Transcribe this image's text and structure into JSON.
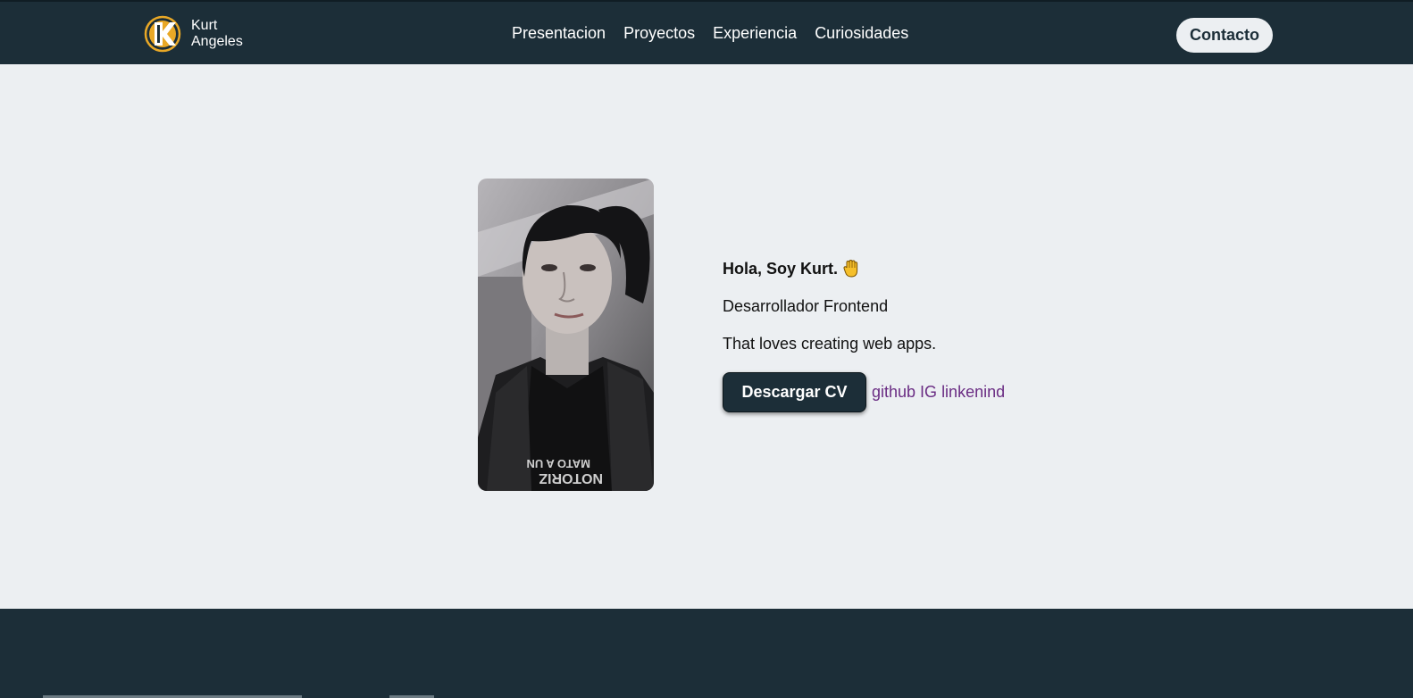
{
  "header": {
    "brand": {
      "first_name": "Kurt",
      "last_name": "Angeles",
      "logo_icon": "k-logo-icon",
      "logo_color": "#e9a826"
    },
    "nav": [
      "Presentacion",
      "Proyectos",
      "Experiencia",
      "Curiosidades"
    ],
    "contact_label": "Contacto"
  },
  "hero": {
    "greeting": "Hola, Soy Kurt.",
    "greeting_icon": "raised-hand-icon",
    "role": "Desarrollador Frontend",
    "tagline": "That loves creating web apps.",
    "cv_button": "Descargar CV",
    "social_links": [
      "github",
      "IG",
      "linkenind"
    ]
  },
  "colors": {
    "navbar": "#1c2e38",
    "page_background": "#eceff2",
    "accent": "#e9a826",
    "link_visited": "#6a2c83"
  }
}
